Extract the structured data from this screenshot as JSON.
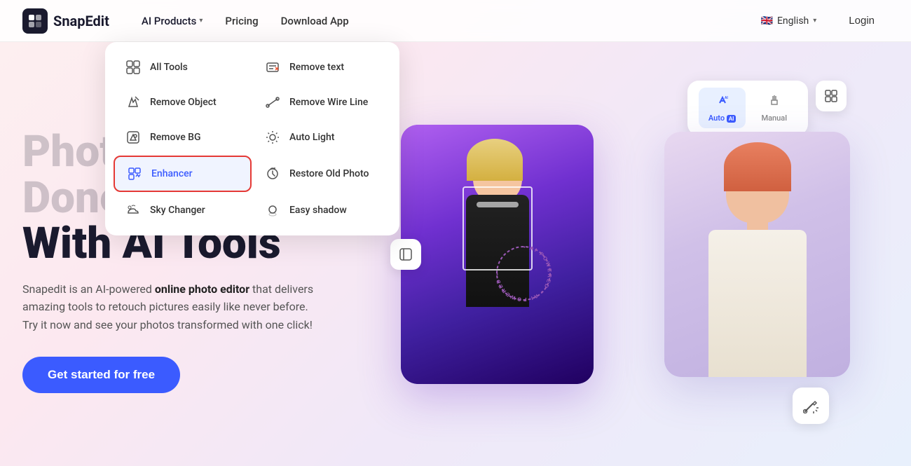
{
  "brand": {
    "name": "SnapEdit",
    "logo_text": "S"
  },
  "navbar": {
    "ai_products_label": "AI Products",
    "pricing_label": "Pricing",
    "download_label": "Download App",
    "language": "English",
    "login_label": "Login"
  },
  "dropdown": {
    "items": [
      {
        "id": "all-tools",
        "label": "All Tools",
        "icon": "⊞"
      },
      {
        "id": "remove-text",
        "label": "Remove text",
        "icon": "T"
      },
      {
        "id": "remove-object",
        "label": "Remove Object",
        "icon": "✏"
      },
      {
        "id": "remove-wire",
        "label": "Remove Wire Line",
        "icon": "↗"
      },
      {
        "id": "remove-bg",
        "label": "Remove BG",
        "icon": "⬡"
      },
      {
        "id": "auto-light",
        "label": "Auto Light",
        "icon": "☀"
      },
      {
        "id": "enhancer",
        "label": "Enhancer",
        "icon": "◫",
        "highlighted": true
      },
      {
        "id": "restore-photo",
        "label": "Restore Old Photo",
        "icon": "🔄"
      },
      {
        "id": "sky-changer",
        "label": "Sky Changer",
        "icon": "☁"
      },
      {
        "id": "easy-shadow",
        "label": "Easy shadow",
        "icon": "●"
      }
    ]
  },
  "hero": {
    "title_line1": "Ph",
    "title_line2": "Do",
    "title_line3": "With AI Tools",
    "description": "Snapedit is an AI-powered online photo editor that delivers amazing tools to retouch pictures easily like never before. Try it now and see your photos transformed with one click!",
    "cta_label": "Get started for free"
  },
  "image_ui": {
    "auto_label": "Auto",
    "manual_label": "Manual"
  },
  "colors": {
    "primary": "#3b5bff",
    "highlight_border": "#e53935",
    "highlight_bg": "#f0f4ff",
    "highlight_text": "#3b5bff"
  }
}
